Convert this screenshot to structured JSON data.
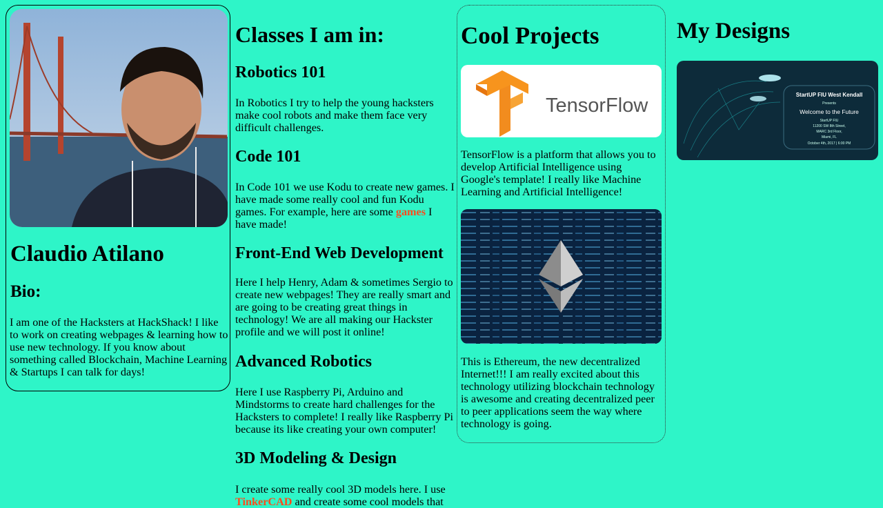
{
  "profile": {
    "name": "Claudio Atilano",
    "bio_heading": "Bio:",
    "bio": "I am one of the Hacksters at HackShack! I like to work on creating webpages & learning how to use new technology. If you know about something called Blockchain, Machine Learning & Startups I can talk for days!"
  },
  "classes": {
    "title": "Classes I am in:",
    "items": [
      {
        "name": "Robotics 101",
        "desc": "In Robotics I try to help the young hacksters make cool robots and make them face very difficult challenges."
      },
      {
        "name": "Code 101",
        "desc_pre": "In Code 101 we use Kodu to create new games. I have made some really cool and fun Kodu games. For example, here are some ",
        "link": "games",
        "desc_post": " I have made!"
      },
      {
        "name": "Front-End Web Development",
        "desc": "Here I help Henry, Adam & sometimes Sergio to create new webpages! They are really smart and are going to be creating great things in technology! We are all making our Hackster profile and we will post it online!"
      },
      {
        "name": "Advanced Robotics",
        "desc": "Here I use Raspberry Pi, Arduino and Mindstorms to create hard challenges for the Hacksters to complete! I really like Raspberry Pi because its like creating your own computer!"
      },
      {
        "name": "3D Modeling & Design",
        "desc_pre": "I create some really cool 3D models here. I use ",
        "link": "TinkerCAD",
        "desc_post": " and create some cool models that"
      }
    ]
  },
  "projects": {
    "title": "Cool Projects",
    "tensorflow_logo_text": "TensorFlow",
    "tensorflow_desc": "TensorFlow is a platform that allows you to develop Artificial Intelligence using Google's template! I really like Machine Learning and Artificial Intelligence!",
    "ethereum_desc": "This is Ethereum, the new decentralized Internet!!! I am really excited about this technology utilizing blockchain technology is awesome and creating decentralized peer to peer applications seem the way where technology is going."
  },
  "designs": {
    "title": "My Designs",
    "flyer": {
      "org": "StartUP FIU West Kendall",
      "presents": "Presents",
      "headline": "Welcome to the Future",
      "line1": "StartUP FIU",
      "line2": "11200 SW 8th Street,",
      "line3": "MARC 3rd Floor,",
      "line4": "Miami, FL",
      "line5": "October 4th, 2017 | 6:00 PM"
    }
  }
}
